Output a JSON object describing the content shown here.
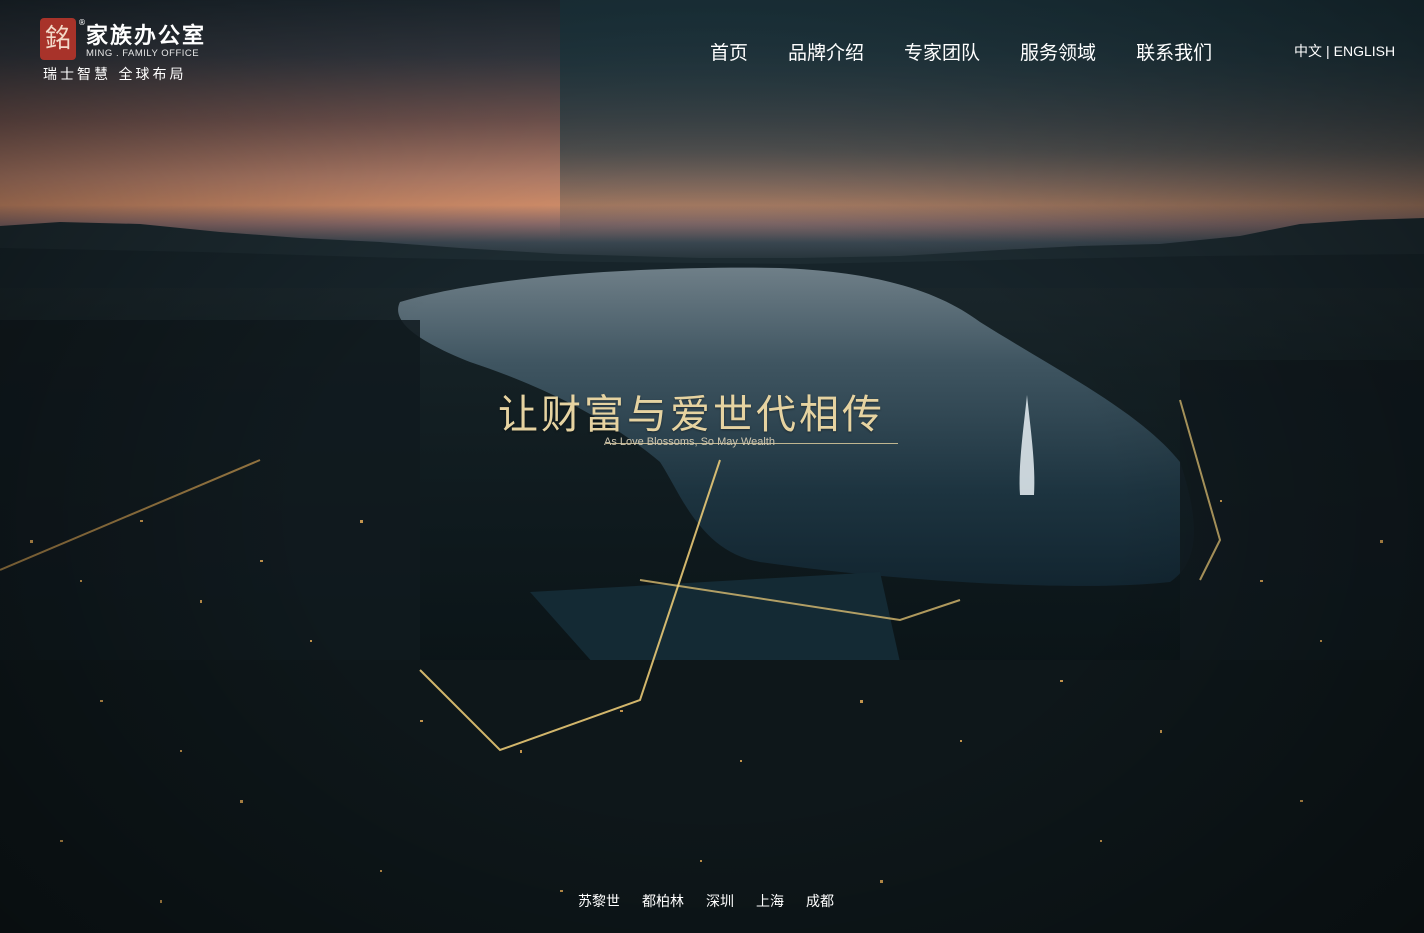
{
  "logo": {
    "seal": "銘",
    "title": "家族办公室",
    "reg": "®",
    "subtitle": "MING . FAMILY OFFICE",
    "tagline": "瑞士智慧  全球布局"
  },
  "nav": {
    "items": [
      {
        "label": "首页"
      },
      {
        "label": "品牌介绍"
      },
      {
        "label": "专家团队"
      },
      {
        "label": "服务领域"
      },
      {
        "label": "联系我们"
      }
    ]
  },
  "lang": {
    "cn": "中文",
    "separator": "|",
    "en": "ENGLISH"
  },
  "hero": {
    "slogan_cn": "让财富与爱世代相传",
    "slogan_en": "As Love Blossoms, So May Wealth",
    "cities": [
      "苏黎世",
      "都柏林",
      "深圳",
      "上海",
      "成都"
    ]
  }
}
